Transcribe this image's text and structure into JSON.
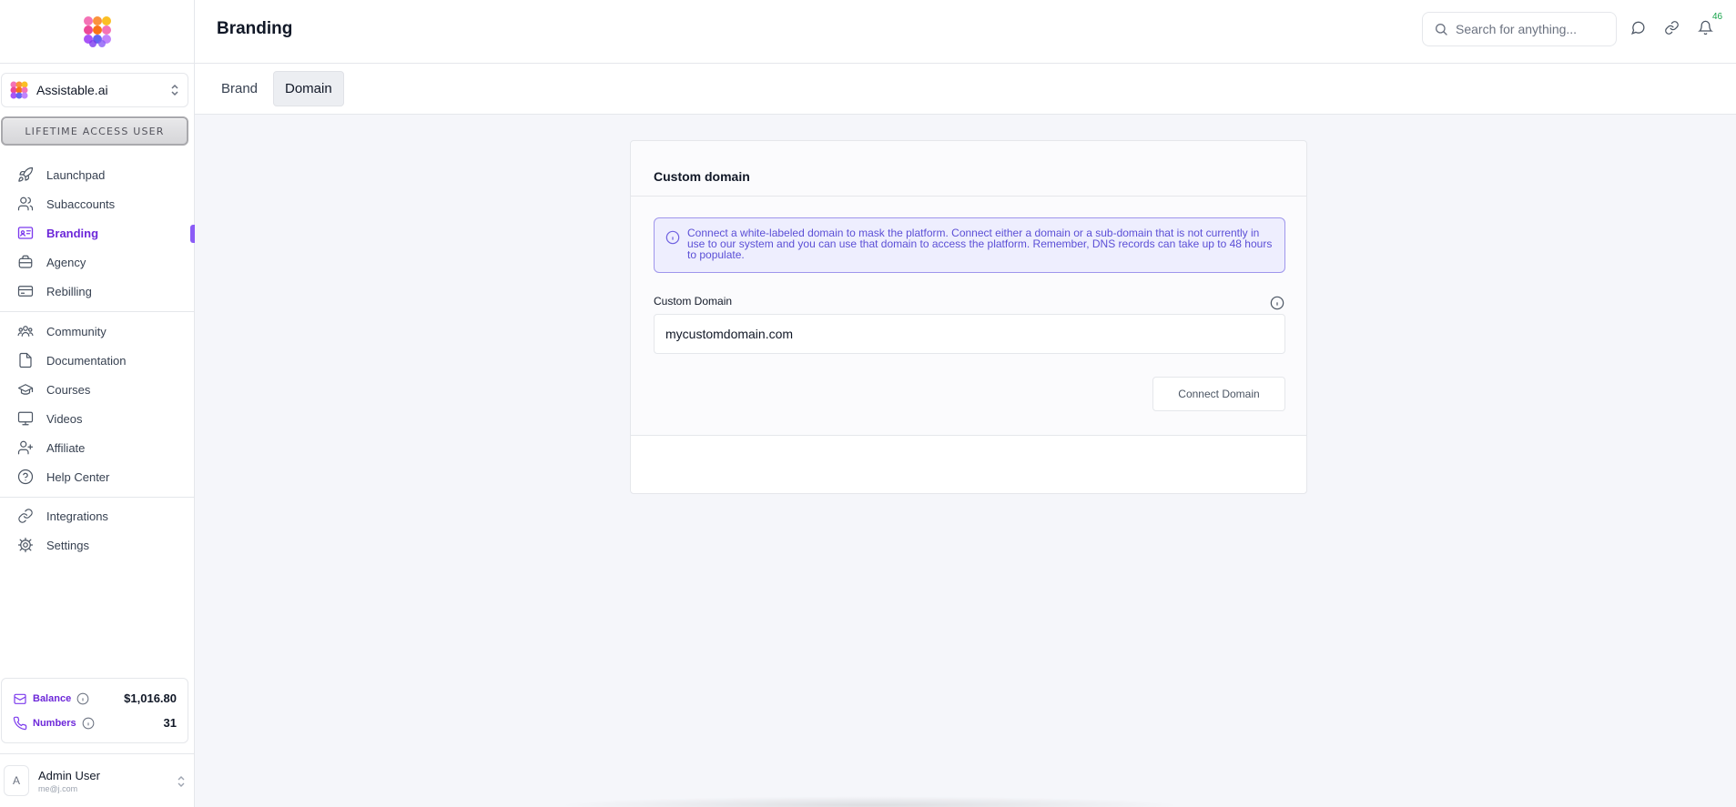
{
  "app": {
    "brand_colors": [
      "#f472b6",
      "#fb923c",
      "#a855f7",
      "#6366f1"
    ],
    "accent": "#7c3aed"
  },
  "workspace": {
    "name": "Assistable.ai"
  },
  "badge": {
    "label": "LIFETIME ACCESS USER"
  },
  "sidebar": {
    "groups": [
      [
        {
          "label": "Launchpad",
          "icon": "rocket-icon"
        },
        {
          "label": "Subaccounts",
          "icon": "users-icon"
        },
        {
          "label": "Branding",
          "icon": "id-card-icon",
          "active": true
        },
        {
          "label": "Agency",
          "icon": "briefcase-icon"
        },
        {
          "label": "Rebilling",
          "icon": "credit-card-icon"
        }
      ],
      [
        {
          "label": "Community",
          "icon": "community-icon"
        },
        {
          "label": "Documentation",
          "icon": "file-icon"
        },
        {
          "label": "Courses",
          "icon": "graduation-cap-icon"
        },
        {
          "label": "Videos",
          "icon": "monitor-icon"
        },
        {
          "label": "Affiliate",
          "icon": "user-plus-icon"
        },
        {
          "label": "Help Center",
          "icon": "help-circle-icon"
        }
      ],
      [
        {
          "label": "Integrations",
          "icon": "link-icon"
        },
        {
          "label": "Settings",
          "icon": "gear-icon"
        }
      ]
    ]
  },
  "balance": {
    "label": "Balance",
    "value": "$1,016.80"
  },
  "numbers": {
    "label": "Numbers",
    "value": "31"
  },
  "user": {
    "initial": "A",
    "name": "Admin User",
    "email": "me@j.com"
  },
  "header": {
    "title": "Branding",
    "search_placeholder": "Search for anything...",
    "notification_count": "46"
  },
  "tabs": [
    {
      "label": "Brand",
      "active": false
    },
    {
      "label": "Domain",
      "active": true
    }
  ],
  "card": {
    "title": "Custom domain",
    "alert": "Connect a white-labeled domain to mask the platform. Connect either a domain or a sub-domain that is not currently in use to our system and you can use that domain to access the platform. Remember, DNS records can take up to 48 hours to populate.",
    "field_label": "Custom Domain",
    "field_value": "mycustomdomain.com",
    "button_label": "Connect Domain"
  }
}
